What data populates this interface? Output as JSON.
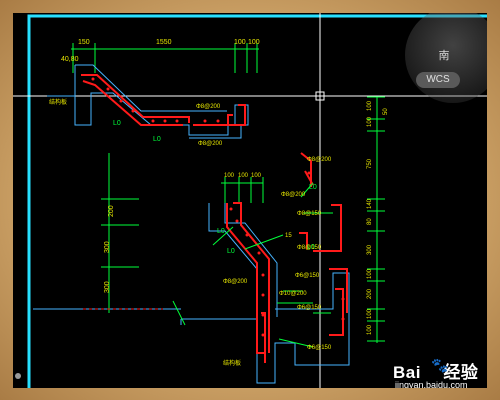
{
  "viewcube": {
    "south_label": "南",
    "wcs_label": "WCS"
  },
  "watermark": {
    "brand_left": "Bai",
    "brand_right": "经验",
    "url": "jingyan.baidu.com"
  },
  "drawing": {
    "dims_top": [
      "150",
      "1550",
      "100",
      "100"
    ],
    "dim_4080": "40,80",
    "dims_mid_top": [
      "100",
      "100",
      "100"
    ],
    "dims_left_vertical": [
      "200",
      "300",
      "300"
    ],
    "dims_right_vertical": [
      "100",
      "100",
      "50",
      "750",
      "140",
      "80",
      "300",
      "100",
      "200",
      "100",
      "100"
    ],
    "rebar_labels": [
      "Φ8@200",
      "Φ8@200",
      "Φ8@200",
      "Φ8@200",
      "Φ8@150",
      "Φ8@150",
      "Φ8@200",
      "Φ10@200",
      "Φ6@150",
      "Φ6@150",
      "Φ6@150"
    ],
    "lap_labels": [
      "L0",
      "L0",
      "L0",
      "L0",
      "L0",
      "L0"
    ],
    "note_labels": [
      "结构板",
      "结构板"
    ],
    "small_label": "15"
  },
  "colors": {
    "rebar": "#ff1a1a",
    "dim": "#00ff3a",
    "text": "#e6e600",
    "outline": "#46b4ff",
    "crosshair": "#ffffff",
    "border": "#28e0ff"
  }
}
